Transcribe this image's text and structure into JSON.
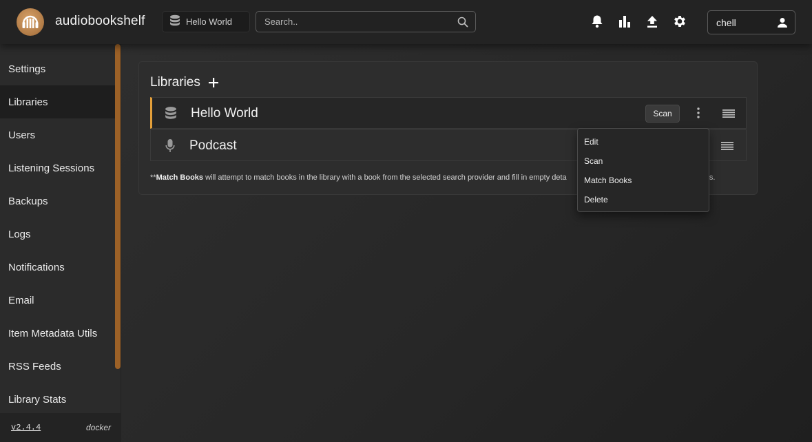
{
  "app": {
    "title": "audiobookshelf"
  },
  "header": {
    "current_library": "Hello World",
    "search_placeholder": "Search..",
    "username": "chell",
    "icons": [
      "bell-icon",
      "stats-icon",
      "upload-icon",
      "gear-icon",
      "user-icon"
    ]
  },
  "sidebar": {
    "items": [
      {
        "label": "Settings",
        "active": false
      },
      {
        "label": "Libraries",
        "active": true
      },
      {
        "label": "Users",
        "active": false
      },
      {
        "label": "Listening Sessions",
        "active": false
      },
      {
        "label": "Backups",
        "active": false
      },
      {
        "label": "Logs",
        "active": false
      },
      {
        "label": "Notifications",
        "active": false
      },
      {
        "label": "Email",
        "active": false
      },
      {
        "label": "Item Metadata Utils",
        "active": false
      },
      {
        "label": "RSS Feeds",
        "active": false
      },
      {
        "label": "Library Stats",
        "active": false
      }
    ],
    "version": "v2.4.4",
    "build": "docker"
  },
  "libraries_panel": {
    "title": "Libraries",
    "libraries": [
      {
        "name": "Hello World",
        "icon": "database-icon",
        "scan_label": "Scan"
      },
      {
        "name": "Podcast",
        "icon": "microphone-icon"
      }
    ],
    "note_prefix": "**",
    "note_bold": "Match Books",
    "note_text": " will attempt to match books in the library with a book from the selected search provider and fill in empty deta",
    "note_tail": "etails."
  },
  "context_menu": {
    "items": [
      "Edit",
      "Scan",
      "Match Books",
      "Delete"
    ]
  },
  "colors": {
    "accent": "#e39f3a",
    "scrollbar": "#9c6127",
    "logo": "#c08a52"
  }
}
